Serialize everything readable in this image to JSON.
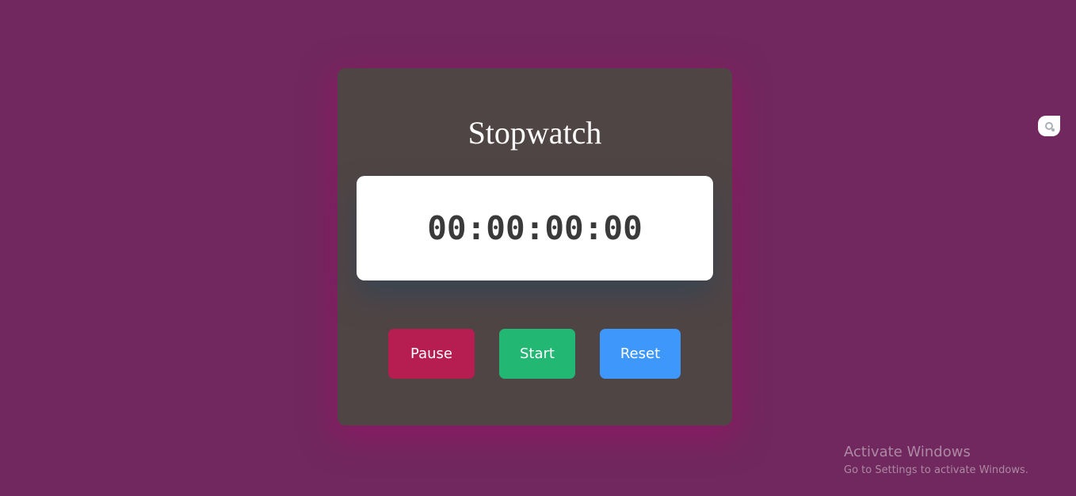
{
  "stopwatch": {
    "title": "Stopwatch",
    "time_display": "00:00:00:00",
    "buttons": {
      "pause_label": "Pause",
      "start_label": "Start",
      "reset_label": "Reset"
    }
  },
  "colors": {
    "background": "#71285e",
    "card": "#504545",
    "pause": "#b61d50",
    "start": "#22b773",
    "reset": "#3e98fb"
  },
  "icons": {
    "side_widget": "search-bubble-icon"
  },
  "watermark": {
    "title": "Activate Windows",
    "subtitle": "Go to Settings to activate Windows."
  }
}
